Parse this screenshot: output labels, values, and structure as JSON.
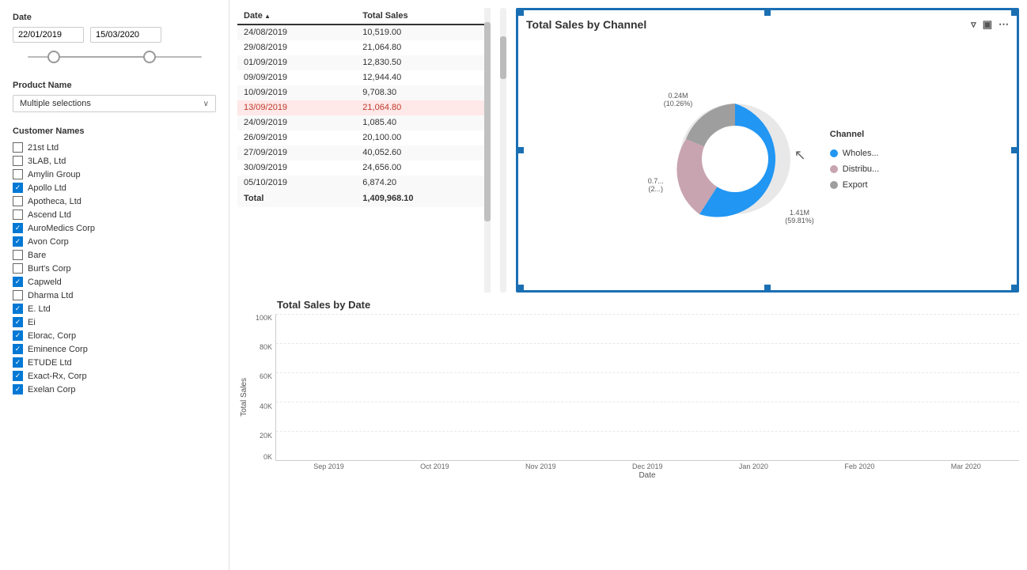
{
  "sidebar": {
    "date_label": "Date",
    "date_start": "22/01/2019",
    "date_end": "15/03/2020",
    "product_label": "Product Name",
    "product_value": "Multiple selections",
    "customer_label": "Customer Names",
    "customers": [
      {
        "name": "21st Ltd",
        "checked": false
      },
      {
        "name": "3LAB, Ltd",
        "checked": false
      },
      {
        "name": "Amylin Group",
        "checked": false
      },
      {
        "name": "Apollo Ltd",
        "checked": true
      },
      {
        "name": "Apotheca, Ltd",
        "checked": false
      },
      {
        "name": "Ascend Ltd",
        "checked": false
      },
      {
        "name": "AuroMedics Corp",
        "checked": true
      },
      {
        "name": "Avon Corp",
        "checked": true
      },
      {
        "name": "Bare",
        "checked": false
      },
      {
        "name": "Burt's Corp",
        "checked": false
      },
      {
        "name": "Capweld",
        "checked": true
      },
      {
        "name": "Dharma Ltd",
        "checked": false
      },
      {
        "name": "E. Ltd",
        "checked": true
      },
      {
        "name": "Ei",
        "checked": true
      },
      {
        "name": "Elorac, Corp",
        "checked": true
      },
      {
        "name": "Eminence Corp",
        "checked": true
      },
      {
        "name": "ETUDE Ltd",
        "checked": true
      },
      {
        "name": "Exact-Rx, Corp",
        "checked": true
      },
      {
        "name": "Exelan Corp",
        "checked": true
      }
    ]
  },
  "table": {
    "col1": "Date",
    "col2": "Total Sales",
    "rows": [
      {
        "date": "24/08/2019",
        "sales": "10,519.00",
        "highlight": false
      },
      {
        "date": "29/08/2019",
        "sales": "21,064.80",
        "highlight": false
      },
      {
        "date": "01/09/2019",
        "sales": "12,830.50",
        "highlight": false
      },
      {
        "date": "09/09/2019",
        "sales": "12,944.40",
        "highlight": false
      },
      {
        "date": "10/09/2019",
        "sales": "9,708.30",
        "highlight": false
      },
      {
        "date": "13/09/2019",
        "sales": "21,064.80",
        "highlight": true
      },
      {
        "date": "24/09/2019",
        "sales": "1,085.40",
        "highlight": false
      },
      {
        "date": "26/09/2019",
        "sales": "20,100.00",
        "highlight": false
      },
      {
        "date": "27/09/2019",
        "sales": "40,052.60",
        "highlight": false
      },
      {
        "date": "30/09/2019",
        "sales": "24,656.00",
        "highlight": false
      },
      {
        "date": "05/10/2019",
        "sales": "6,874.20",
        "highlight": false
      }
    ],
    "total_label": "Total",
    "total_value": "1,409,968.10"
  },
  "donut_chart": {
    "title": "Total Sales by Channel",
    "segments": [
      {
        "label": "Wholes...",
        "value": "1.41M",
        "pct": "59.81%",
        "color": "#2196F3"
      },
      {
        "label": "Distribu...",
        "value": "0.24M",
        "pct": "10.26%",
        "color": "#c8a4b0"
      },
      {
        "label": "Export",
        "value": "0.7...",
        "pct": "2...%",
        "color": "#9e9e9e"
      }
    ],
    "annotations": [
      {
        "text": "0.24M",
        "sub": "(10.26%)"
      },
      {
        "text": "0.7...",
        "sub": "(2...)"
      },
      {
        "text": "1.41M",
        "sub": "(59.81%)"
      }
    ]
  },
  "bar_chart": {
    "title": "Total Sales by Date",
    "y_label": "Total Sales",
    "x_label": "Date",
    "y_ticks": [
      "100K",
      "80K",
      "60K",
      "40K",
      "20K",
      "0K"
    ],
    "x_labels": [
      "Sep 2019",
      "Oct 2019",
      "Nov 2019",
      "Dec 2019",
      "Jan 2020",
      "Feb 2020",
      "Mar 2020"
    ]
  }
}
